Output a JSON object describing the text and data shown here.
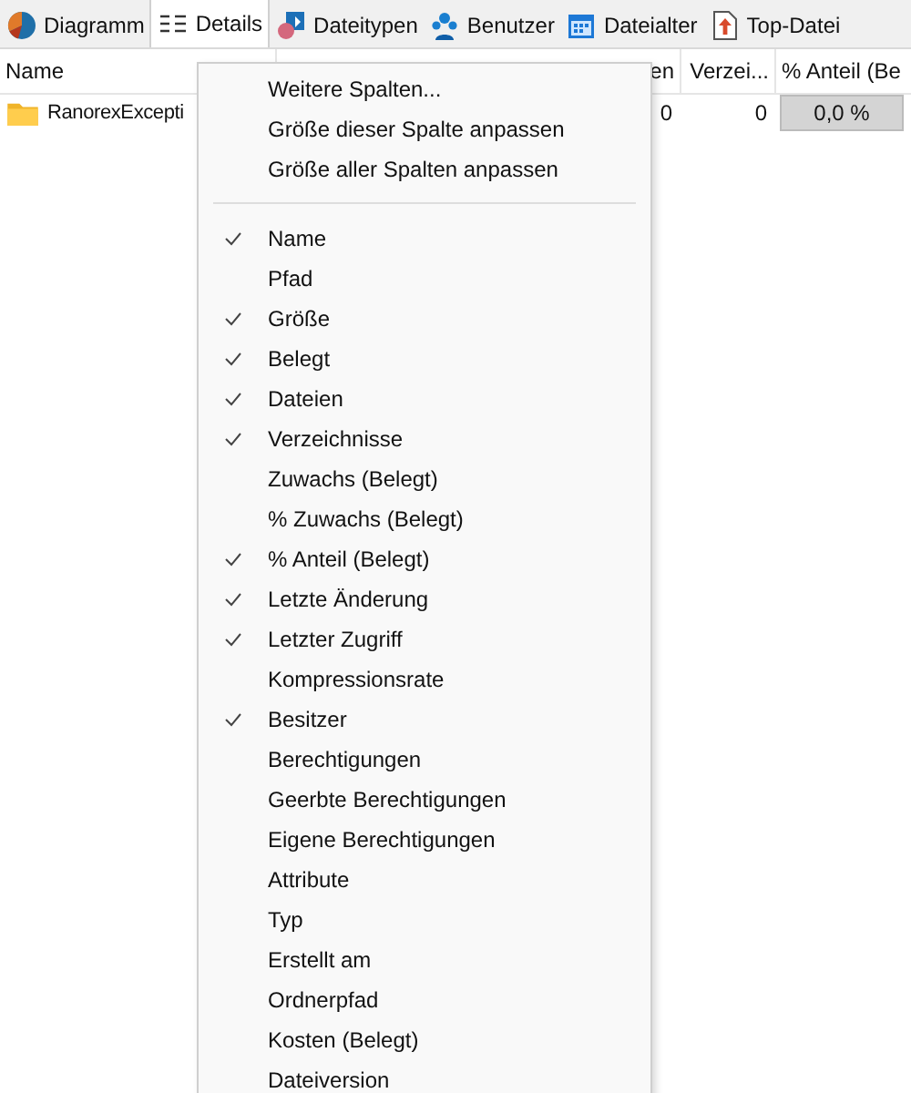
{
  "tabs": [
    {
      "label": "Diagramm",
      "selected": false
    },
    {
      "label": "Details",
      "selected": true
    },
    {
      "label": "Dateitypen",
      "selected": false
    },
    {
      "label": "Benutzer",
      "selected": false
    },
    {
      "label": "Dateialter",
      "selected": false
    },
    {
      "label": "Top-Datei",
      "selected": false
    }
  ],
  "table": {
    "columns": [
      {
        "label": "Name"
      },
      {
        "label": "en"
      },
      {
        "label": "Verzei..."
      },
      {
        "label": "% Anteil (Be"
      }
    ],
    "rows": [
      {
        "cells": [
          "RanorexExcepti",
          "0",
          "0",
          "0,0 %"
        ]
      }
    ]
  },
  "context_menu": {
    "actions": [
      {
        "label": "Weitere Spalten..."
      },
      {
        "label": "Größe dieser Spalte anpassen"
      },
      {
        "label": "Größe aller Spalten anpassen"
      }
    ],
    "columns": [
      {
        "label": "Name",
        "checked": true
      },
      {
        "label": "Pfad",
        "checked": false
      },
      {
        "label": "Größe",
        "checked": true
      },
      {
        "label": "Belegt",
        "checked": true
      },
      {
        "label": "Dateien",
        "checked": true
      },
      {
        "label": "Verzeichnisse",
        "checked": true
      },
      {
        "label": "Zuwachs (Belegt)",
        "checked": false
      },
      {
        "label": "% Zuwachs (Belegt)",
        "checked": false
      },
      {
        "label": "% Anteil (Belegt)",
        "checked": true
      },
      {
        "label": "Letzte Änderung",
        "checked": true
      },
      {
        "label": "Letzter Zugriff",
        "checked": true
      },
      {
        "label": "Kompressionsrate",
        "checked": false
      },
      {
        "label": "Besitzer",
        "checked": true
      },
      {
        "label": "Berechtigungen",
        "checked": false
      },
      {
        "label": "Geerbte Berechtigungen",
        "checked": false
      },
      {
        "label": "Eigene Berechtigungen",
        "checked": false
      },
      {
        "label": "Attribute",
        "checked": false
      },
      {
        "label": "Typ",
        "checked": false
      },
      {
        "label": "Erstellt am",
        "checked": false
      },
      {
        "label": "Ordnerpfad",
        "checked": false
      },
      {
        "label": "Kosten (Belegt)",
        "checked": false
      },
      {
        "label": "Dateiversion",
        "checked": false
      }
    ]
  }
}
